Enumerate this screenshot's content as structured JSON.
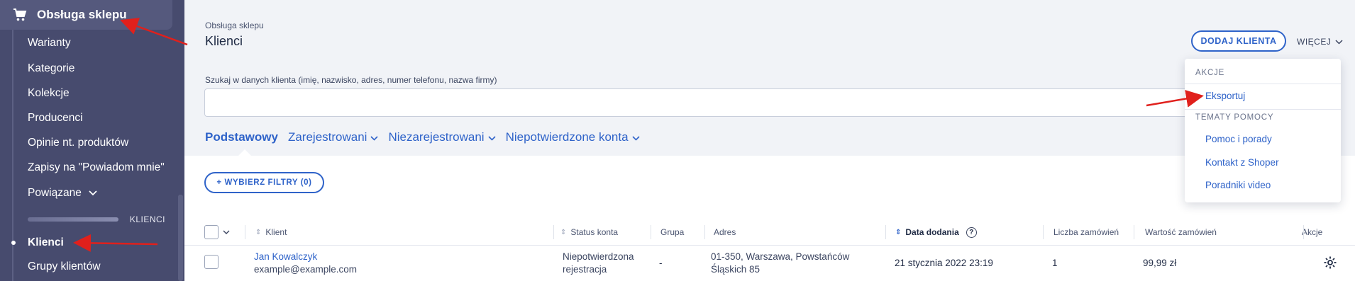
{
  "sidebar": {
    "section_title": "Obsługa sklepu",
    "items": [
      {
        "label": "Warianty"
      },
      {
        "label": "Kategorie"
      },
      {
        "label": "Kolekcje"
      },
      {
        "label": "Producenci"
      },
      {
        "label": "Opinie nt. produktów"
      },
      {
        "label": "Zapisy na \"Powiadom mnie\""
      },
      {
        "label": "Powiązane"
      }
    ],
    "group_label": "KLIENCI",
    "group_items": [
      {
        "label": "Klienci",
        "active": true
      },
      {
        "label": "Grupy klientów"
      }
    ]
  },
  "header": {
    "breadcrumb": "Obsługa sklepu",
    "title": "Klienci",
    "add_button": "DODAJ KLIENTA",
    "more_button": "WIĘCEJ"
  },
  "search": {
    "label": "Szukaj w danych klienta (imię, nazwisko, adres, numer telefonu, nazwa firmy)",
    "value": ""
  },
  "tabs": [
    {
      "label": "Podstawowy",
      "active": true
    },
    {
      "label": "Zarejestrowani"
    },
    {
      "label": "Niezarejestrowani"
    },
    {
      "label": "Niepotwierdzone konta"
    }
  ],
  "filters_button": "+ WYBIERZ FILTRY (0)",
  "table": {
    "columns": {
      "client": "Klient",
      "status": "Status konta",
      "group": "Grupa",
      "address": "Adres",
      "date": "Data dodania",
      "orders": "Liczba zamówień",
      "value": "Wartość zamówień",
      "actions": "Akcje"
    },
    "rows": [
      {
        "name": "Jan Kowalczyk",
        "email": "example@example.com",
        "status_line1": "Niepotwierdzona",
        "status_line2": "rejestracja",
        "group": "-",
        "address_line1": "01-350, Warszawa, Powstańców",
        "address_line2": "Śląskich 85",
        "date": "21 stycznia 2022 23:19",
        "orders": "1",
        "value": "99,99 zł"
      }
    ]
  },
  "dropdown": {
    "section1": "AKCJE",
    "item_export": "Eksportuj",
    "section2": "TEMATY POMOCY",
    "item_help": "Pomoc i porady",
    "item_contact": "Kontakt z Shoper",
    "item_video": "Poradniki video"
  },
  "colors": {
    "sidebar_bg": "#474b6e",
    "accent": "#2f63c9",
    "annotation": "#e0201c"
  }
}
